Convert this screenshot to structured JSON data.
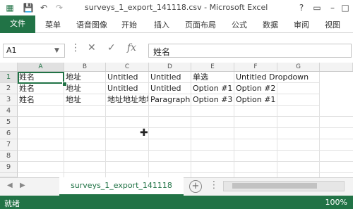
{
  "window": {
    "title": "surveys_1_export_141118.csv - Microsoft Excel"
  },
  "quick_access": {
    "save_icon": "save-icon",
    "undo_icon": "undo-icon",
    "redo_icon": "redo-icon"
  },
  "ribbon": {
    "file_label": "文件",
    "tabs": [
      "菜单",
      "语音图像",
      "开始",
      "插入",
      "页面布局",
      "公式",
      "数据",
      "审阅",
      "视图"
    ]
  },
  "formula_bar": {
    "name_box": "A1",
    "formula": "姓名",
    "fx_label": "fx"
  },
  "grid": {
    "columns": [
      "A",
      "B",
      "C",
      "D",
      "E",
      "F",
      "G"
    ],
    "rows": [
      "1",
      "2",
      "3",
      "4",
      "5",
      "6",
      "7",
      "8",
      "9",
      "10"
    ],
    "cells": [
      [
        "姓名",
        "地址",
        "Untitled",
        "Untitled",
        "单选",
        "Untitled Dropdown",
        ""
      ],
      [
        "姓名",
        "地址",
        "Untitled",
        "Untitled",
        "Option #1",
        "Option #2",
        ""
      ],
      [
        "姓名",
        "地址",
        "地址地址地址",
        "Paragraph",
        "Option #3",
        "Option #1",
        ""
      ]
    ]
  },
  "sheets": {
    "active": "surveys_1_export_141118"
  },
  "status": {
    "label": "就绪",
    "zoom": "100%"
  }
}
